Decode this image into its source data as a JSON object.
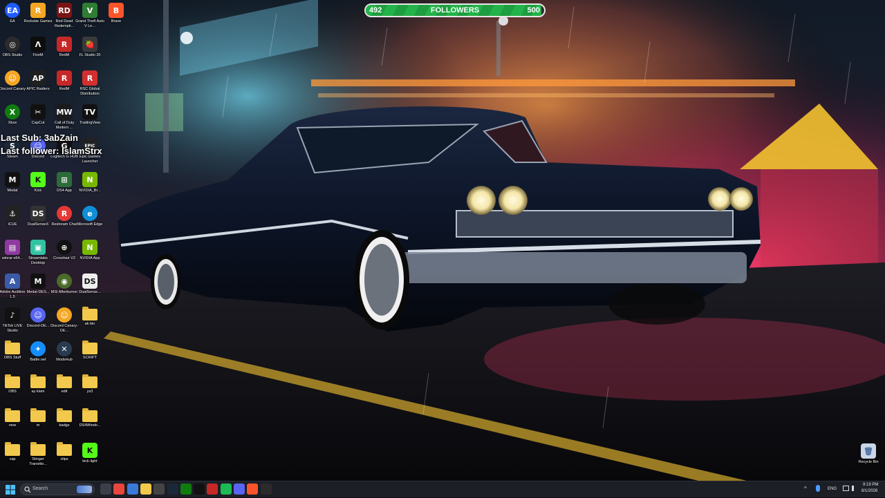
{
  "desktop": {
    "icons": [
      {
        "label": "EA",
        "glyph": "EA",
        "color": "#1f5cff",
        "shape": "circle",
        "icon": "ea-icon"
      },
      {
        "label": "Rockstar Games",
        "glyph": "R",
        "color": "#f5a623",
        "icon": "rockstar-icon"
      },
      {
        "label": "Red Dead Redempti...",
        "glyph": "RD",
        "color": "#7a1414",
        "icon": "red-dead-icon"
      },
      {
        "label": "Grand Theft Auto V Le...",
        "glyph": "V",
        "color": "#2f7d32",
        "icon": "gta-icon"
      },
      {
        "label": "Brave",
        "glyph": "B",
        "color": "#fb542b",
        "icon": "brave-icon"
      },
      {
        "label": "OBS Studio",
        "glyph": "◎",
        "color": "#2b2b2b",
        "shape": "circle",
        "icon": "obs-icon"
      },
      {
        "label": "FiveM",
        "glyph": "Λ",
        "color": "#0d0d0d",
        "icon": "fivem-icon"
      },
      {
        "label": "RedM",
        "glyph": "R",
        "color": "#c62828",
        "icon": "redm-icon"
      },
      {
        "label": "FL Studio 20",
        "glyph": "🍓",
        "color": "#3a3a3a",
        "icon": "fl-studio-icon"
      },
      {
        "label": "Discord Canary",
        "glyph": "☺",
        "color": "#f5a623",
        "shape": "circle",
        "icon": "discord-canary-icon"
      },
      {
        "label": "APIC Raiders",
        "glyph": "AP",
        "color": "#202020",
        "icon": "apic-icon"
      },
      {
        "label": "RedM",
        "glyph": "R",
        "color": "#c62828",
        "icon": "redm-icon-2"
      },
      {
        "label": "RSC Global Distribution",
        "glyph": "R",
        "color": "#d32f2f",
        "icon": "rsc-icon"
      },
      {
        "label": "Xbox",
        "glyph": "X",
        "color": "#107c10",
        "shape": "circle",
        "icon": "xbox-icon"
      },
      {
        "label": "CapCut",
        "glyph": "✂",
        "color": "#111111",
        "icon": "capcut-icon"
      },
      {
        "label": "Call of Duty Modern ...",
        "glyph": "MW",
        "color": "#1a1a1a",
        "icon": "cod-icon"
      },
      {
        "label": "TradingView",
        "glyph": "TV",
        "color": "#111111",
        "icon": "tradingview-icon"
      },
      {
        "label": "Steam",
        "glyph": "S",
        "color": "#1b2838",
        "shape": "circle",
        "icon": "steam-icon"
      },
      {
        "label": "Discord",
        "glyph": "☺",
        "color": "#5865f2",
        "shape": "circle",
        "icon": "discord-icon"
      },
      {
        "label": "Logitech G HUB",
        "glyph": "G",
        "color": "#111111",
        "icon": "logitech-icon"
      },
      {
        "label": "Epic Games Launcher",
        "glyph": "EPIC",
        "color": "#222222",
        "icon": "epic-icon"
      },
      {
        "label": "Medal",
        "glyph": "M",
        "color": "#111111",
        "icon": "medal-icon"
      },
      {
        "label": "Kick",
        "glyph": "K",
        "color": "#53fc18",
        "icon": "kick-icon"
      },
      {
        "label": "DS4 App",
        "glyph": "⊞",
        "color": "#2d6b3a",
        "icon": "ds4-icon"
      },
      {
        "label": "NVIDIA_Br...",
        "glyph": "N",
        "color": "#76b900",
        "icon": "nvidia-broadcast-icon"
      },
      {
        "label": "iCUE",
        "glyph": "⚓",
        "color": "#222222",
        "icon": "icue-icon"
      },
      {
        "label": "DualSenseX",
        "glyph": "DS",
        "color": "#333333",
        "icon": "dualsense-icon"
      },
      {
        "label": "Restream Chat",
        "glyph": "R",
        "color": "#e53935",
        "shape": "circle",
        "icon": "restream-icon"
      },
      {
        "label": "Microsoft Edge",
        "glyph": "e",
        "color": "#0f8fd8",
        "shape": "circle",
        "icon": "edge-icon"
      },
      {
        "label": "winrar-x64...",
        "glyph": "▤",
        "color": "#8e3a9e",
        "icon": "winrar-icon"
      },
      {
        "label": "Streamlabs Desktop",
        "glyph": "▣",
        "color": "#31c3a2",
        "icon": "streamlabs-icon"
      },
      {
        "label": "Crosshair V2",
        "glyph": "⊕",
        "color": "#111111",
        "shape": "circle",
        "icon": "crosshair-icon"
      },
      {
        "label": "NVIDIA App",
        "glyph": "N",
        "color": "#76b900",
        "icon": "nvidia-app-icon"
      },
      {
        "label": "Adobe Audition 1.5",
        "glyph": "A",
        "color": "#3b5ba9",
        "icon": "audition-icon"
      },
      {
        "label": "Medal-DES...",
        "glyph": "M",
        "color": "#111111",
        "icon": "medal-setup-icon"
      },
      {
        "label": "MSI Afterburner",
        "glyph": "◉",
        "color": "#4a6b2a",
        "shape": "circle",
        "icon": "afterburner-icon"
      },
      {
        "label": "DualSense...",
        "glyph": "DS",
        "color": "#eeeeee",
        "icon": "dualsense-setup-icon"
      },
      {
        "label": "TikTok LIVE Studio",
        "glyph": "♪",
        "color": "#111111",
        "icon": "tiktok-icon"
      },
      {
        "label": "Discord-DE...",
        "glyph": "☺",
        "color": "#5865f2",
        "shape": "circle",
        "icon": "discord-setup-icon"
      },
      {
        "label": "Discord Canary-DE...",
        "glyph": "☺",
        "color": "#f5a623",
        "shape": "circle",
        "icon": "discord-canary-setup-icon"
      },
      {
        "label": "ak bin",
        "glyph": "",
        "color": "#f2c94c",
        "shape": "folder",
        "icon": "folder-icon"
      },
      {
        "label": "OBS Stuff",
        "glyph": "",
        "color": "#f2c94c",
        "shape": "folder",
        "icon": "folder-icon"
      },
      {
        "label": "Battle.net",
        "glyph": "✦",
        "color": "#148eff",
        "shape": "circle",
        "icon": "battlenet-icon"
      },
      {
        "label": "ModsHub",
        "glyph": "✕",
        "color": "#2a3b4f",
        "shape": "circle",
        "icon": "modshub-icon"
      },
      {
        "label": "SCRIPT",
        "glyph": "",
        "color": "#f2c94c",
        "shape": "folder",
        "icon": "folder-icon"
      },
      {
        "label": "OBS",
        "glyph": "",
        "color": "#f2c94c",
        "shape": "folder",
        "icon": "folder-icon"
      },
      {
        "label": "ay klam",
        "glyph": "",
        "color": "#f2c94c",
        "shape": "folder",
        "icon": "folder-icon"
      },
      {
        "label": "edit",
        "glyph": "",
        "color": "#f2c94c",
        "shape": "folder",
        "icon": "folder-icon"
      },
      {
        "label": "ys3",
        "glyph": "",
        "color": "#f2c94c",
        "shape": "folder",
        "icon": "folder-icon"
      },
      {
        "label": "new",
        "glyph": "",
        "color": "#f2c94c",
        "shape": "folder",
        "icon": "folder-icon"
      },
      {
        "label": "m",
        "glyph": "",
        "color": "#f2c94c",
        "shape": "folder",
        "icon": "folder-icon"
      },
      {
        "label": "badgs",
        "glyph": "",
        "color": "#f2c94c",
        "shape": "folder",
        "icon": "folder-icon"
      },
      {
        "label": "DS4Windo...",
        "glyph": "",
        "color": "#f2c94c",
        "shape": "folder",
        "icon": "folder-icon"
      },
      {
        "label": "cap",
        "glyph": "",
        "color": "#f2c94c",
        "shape": "folder",
        "icon": "folder-icon"
      },
      {
        "label": "Stinger Transitio...",
        "glyph": "",
        "color": "#f2c94c",
        "shape": "folder",
        "icon": "folder-icon"
      },
      {
        "label": "clips",
        "glyph": "",
        "color": "#f2c94c",
        "shape": "folder",
        "icon": "folder-icon"
      },
      {
        "label": "kick-light",
        "glyph": "K",
        "color": "#53fc18",
        "icon": "kick-light-icon"
      }
    ],
    "recycle_bin": {
      "label": "Recycle Bin"
    }
  },
  "overlay": {
    "goal": {
      "current": "492",
      "label": "FOLLOWERS",
      "target": "500",
      "progress_fraction": 0.984
    },
    "last_sub": "Last Sub: 3abZain",
    "last_follower": "Last follower: IslamStrx"
  },
  "taskbar": {
    "search_placeholder": "Search",
    "apps": [
      {
        "icon": "task-view-icon",
        "color": "#3a3f4a"
      },
      {
        "icon": "chrome-icon",
        "color": "#e8453c"
      },
      {
        "icon": "store-icon",
        "color": "#3a79d8"
      },
      {
        "icon": "file-explorer-icon",
        "color": "#f2c94c"
      },
      {
        "icon": "obs-icon",
        "color": "#444444"
      },
      {
        "icon": "steam-icon",
        "color": "#1b2838"
      },
      {
        "icon": "xbox-icon",
        "color": "#107c10"
      },
      {
        "icon": "fivem-icon",
        "color": "#111111"
      },
      {
        "icon": "redm-icon",
        "color": "#c62828"
      },
      {
        "icon": "spotify-icon",
        "color": "#1db954"
      },
      {
        "icon": "discord-icon",
        "color": "#5865f2"
      },
      {
        "icon": "brave-icon",
        "color": "#fb542b"
      },
      {
        "icon": "obs-icon",
        "color": "#2b2b2b"
      }
    ],
    "tray": {
      "language": "ENG",
      "time": "9:19 PM",
      "date": "8/1/2026"
    }
  }
}
